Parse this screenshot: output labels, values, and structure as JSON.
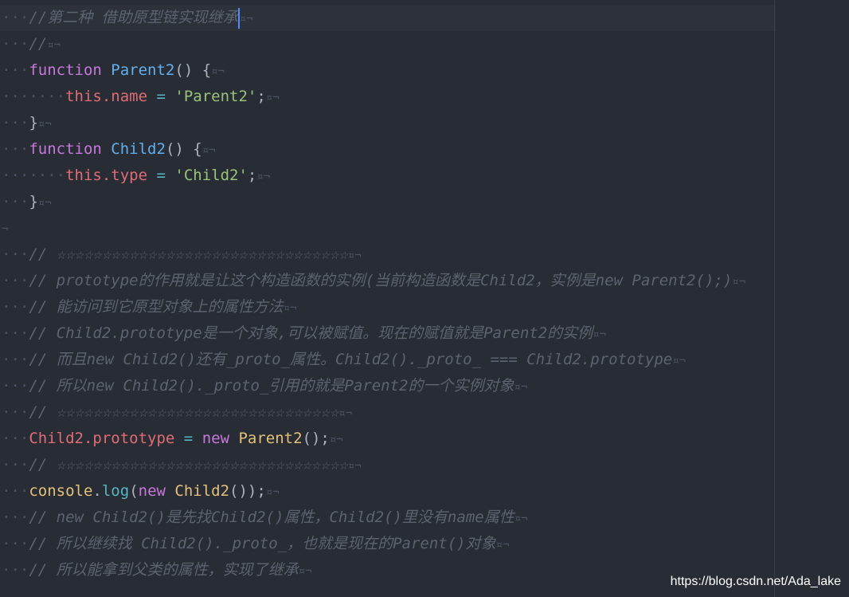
{
  "colors": {
    "background": "#282c34",
    "comment": "#5c6370",
    "keyword": "#c678dd",
    "function": "#61afef",
    "variable": "#e06c75",
    "string": "#98c379",
    "operator": "#56b6c2",
    "class": "#e5c07b",
    "cursor": "#528bff"
  },
  "code": {
    "l1": "//第二种 借助原型链实现继承",
    "l2": "//",
    "l3_kw": "function",
    "l3_name": "Parent2",
    "l3_rest": "() {",
    "l4_this": "this",
    "l4_prop": ".name",
    "l4_eq": " = ",
    "l4_str": "'Parent2'",
    "l4_end": ";",
    "l5": "}",
    "l6_kw": "function",
    "l6_name": "Child2",
    "l6_rest": "() {",
    "l7_this": "this",
    "l7_prop": ".type",
    "l7_eq": " = ",
    "l7_str": "'Child2'",
    "l7_end": ";",
    "l8": "}",
    "l10": "// ☆☆☆☆☆☆☆☆☆☆☆☆☆☆☆☆☆☆☆☆☆☆☆☆☆☆☆☆☆☆☆☆",
    "l11": "// prototype的作用就是让这个构造函数的实例(当前构造函数是Child2，实例是new Parent2();)",
    "l12": "// 能访问到它原型对象上的属性方法",
    "l13": "// Child2.prototype是一个对象,可以被赋值。现在的赋值就是Parent2的实例",
    "l14": "// 而且new Child2()还有_proto_属性。Child2()._proto_ === Child2.prototype",
    "l15": "// 所以new Child2()._proto_引用的就是Parent2的一个实例对象",
    "l16": "// ☆☆☆☆☆☆☆☆☆☆☆☆☆☆☆☆☆☆☆☆☆☆☆☆☆☆☆☆☆☆☆",
    "l17_obj": "Child2",
    "l17_prop": ".prototype",
    "l17_eq": " = ",
    "l17_new": "new",
    "l17_cls": " Parent2",
    "l17_end": "();",
    "l18": "// ☆☆☆☆☆☆☆☆☆☆☆☆☆☆☆☆☆☆☆☆☆☆☆☆☆☆☆☆☆☆☆☆",
    "l19_obj": "console",
    "l19_dot": ".",
    "l19_fn": "log",
    "l19_p1": "(",
    "l19_new": "new",
    "l19_cls": " Child2",
    "l19_end": "());",
    "l20": "// new Child2()是先找Child2()属性，Child2()里没有name属性",
    "l21": "// 所以继续找 Child2()._proto_，也就是现在的Parent()对象",
    "l22": "// 所以能拿到父类的属性，实现了继承"
  },
  "watermark": "https://blog.csdn.net/Ada_lake"
}
